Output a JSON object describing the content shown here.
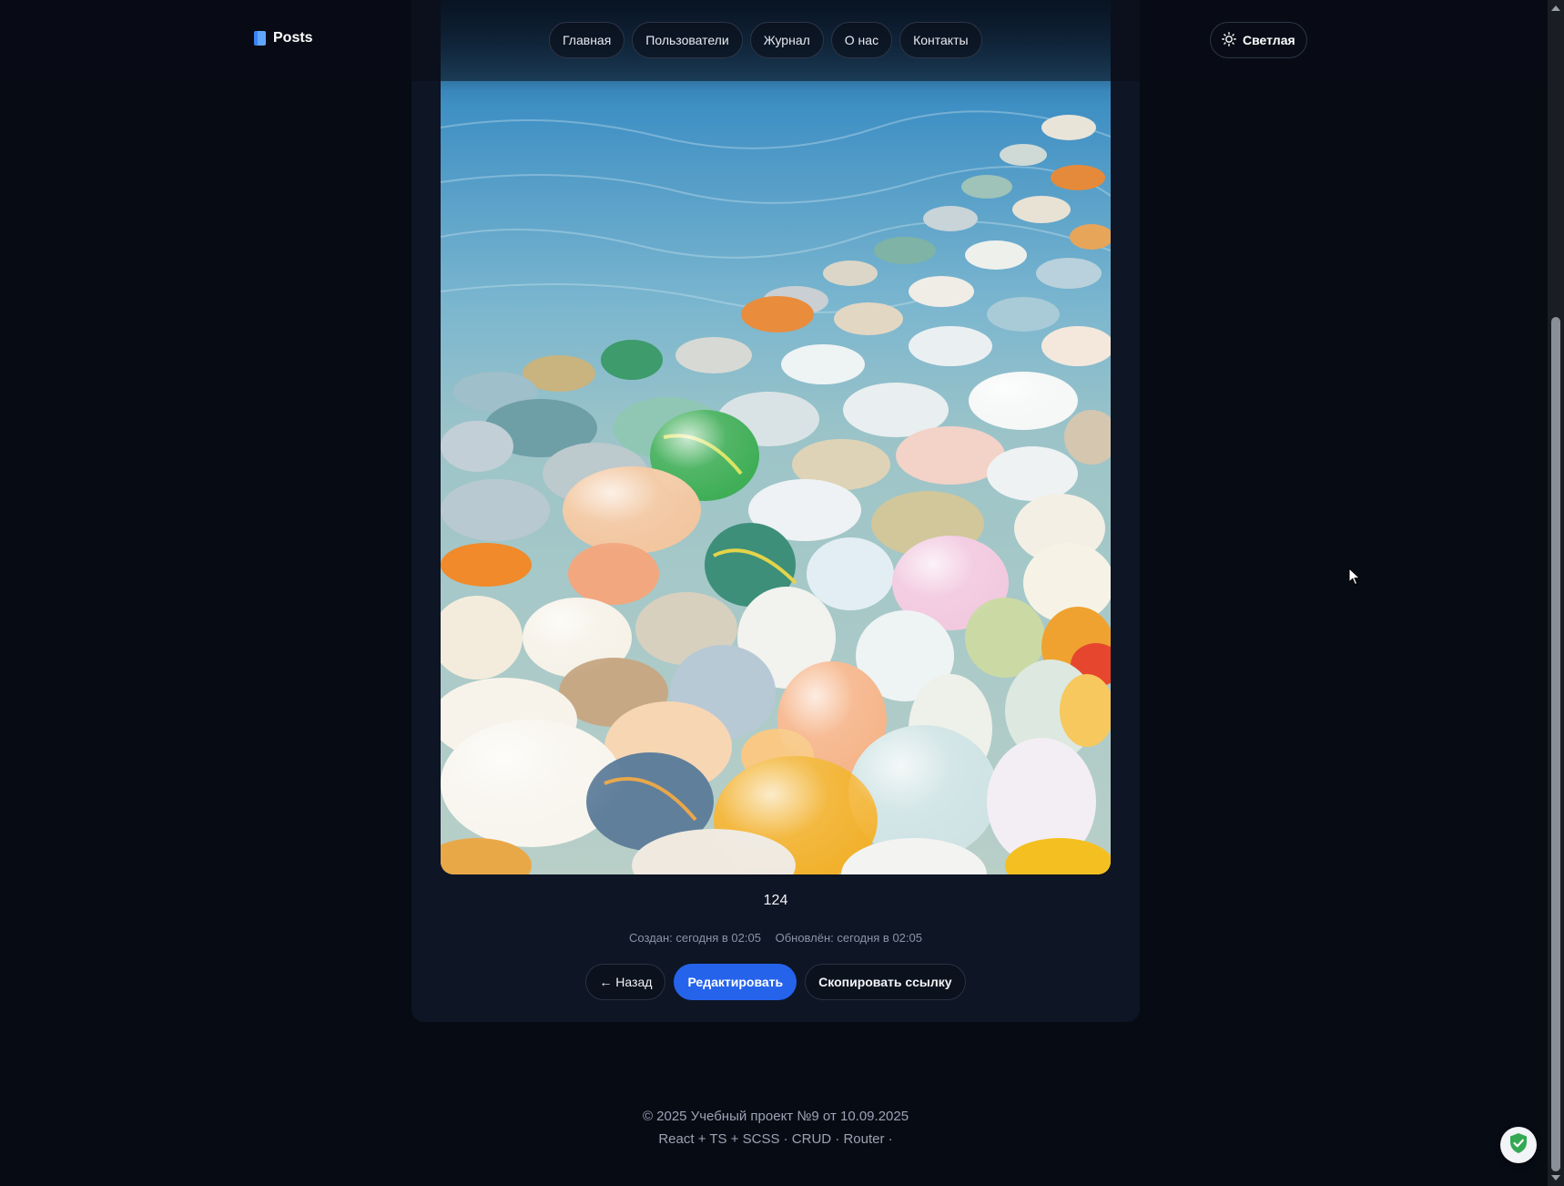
{
  "brand": {
    "name": "Posts",
    "icon": "book-icon"
  },
  "nav": {
    "items": [
      {
        "label": "Главная"
      },
      {
        "label": "Пользователи"
      },
      {
        "label": "Журнал"
      },
      {
        "label": "О нас"
      },
      {
        "label": "Контакты"
      }
    ]
  },
  "theme_toggle": {
    "label": "Светлая",
    "icon": "sun-icon"
  },
  "post": {
    "image": {
      "subject": "colorful-pebbles-beach",
      "icon": "post-image"
    },
    "title": "124",
    "created": "Создан: сегодня в 02:05",
    "updated": "Обновлён: сегодня в 02:05"
  },
  "actions": {
    "back_label": "← Назад",
    "edit_label": "Редактировать",
    "copy_label": "Скопировать ссылку"
  },
  "footer": {
    "line1": "© 2025 Учебный проект №9 от 10.09.2025",
    "line2": "React + TS + SCSS · CRUD · Router ·"
  },
  "colors": {
    "background": "#070b14",
    "card": "#0e1524",
    "primary": "#2563eb",
    "muted_text": "#8a93a6"
  }
}
